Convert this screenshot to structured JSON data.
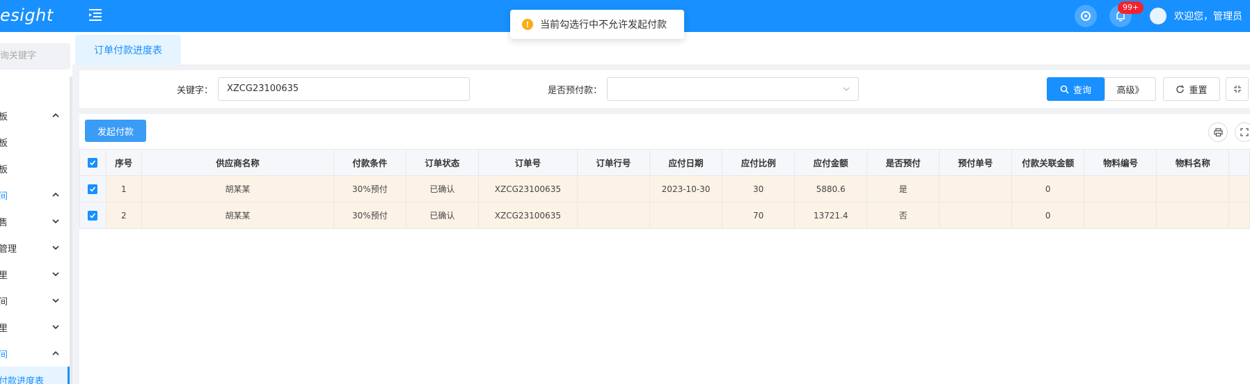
{
  "header": {
    "logo": "esight",
    "notification_count": "99+",
    "welcome": "欢迎您，管理员"
  },
  "toast": {
    "message": "当前勾选行中不允许发起付款",
    "type": "warning",
    "icon": "!"
  },
  "sidebar": {
    "search_placeholder": "询关键字",
    "items": [
      {
        "label": "板",
        "expanded": true
      },
      {
        "label": "板"
      },
      {
        "label": "板"
      },
      {
        "label": "间",
        "expanded": true,
        "highlight": true
      },
      {
        "label": "售"
      },
      {
        "label": "管理"
      },
      {
        "label": "里"
      },
      {
        "label": "间"
      },
      {
        "label": "里"
      },
      {
        "label": "间",
        "expanded": true,
        "highlight": true
      },
      {
        "label": "付款进度表",
        "active": true
      }
    ]
  },
  "tabs": [
    {
      "label": "订单付款进度表",
      "active": true
    }
  ],
  "filter": {
    "keyword_label": "关键字：",
    "keyword_value": "XZCG23100635",
    "prepay_label": "是否预付款：",
    "prepay_value": "",
    "search_button": "查询",
    "advanced_button": "高级》",
    "reset_button": "重置"
  },
  "toolbar": {
    "pay_button": "发起付款"
  },
  "table": {
    "columns": [
      "序号",
      "供应商名称",
      "付款条件",
      "订单状态",
      "订单号",
      "订单行号",
      "应付日期",
      "应付比例",
      "应付金额",
      "是否预付",
      "预付单号",
      "付款关联金额",
      "物料编号",
      "物料名称"
    ],
    "rows": [
      [
        "1",
        "胡某某",
        "30%预付",
        "已确认",
        "XZCG23100635",
        "",
        "2023-10-30",
        "30",
        "5880.6",
        "是",
        "",
        "0",
        "",
        ""
      ],
      [
        "2",
        "胡某某",
        "30%预付",
        "已确认",
        "XZCG23100635",
        "",
        "",
        "70",
        "13721.4",
        "否",
        "",
        "0",
        "",
        ""
      ]
    ]
  },
  "colors": {
    "primary": "#1890ff",
    "selected_row": "#fdf2e6",
    "badge": "#f5222d",
    "warning": "#faad14"
  }
}
